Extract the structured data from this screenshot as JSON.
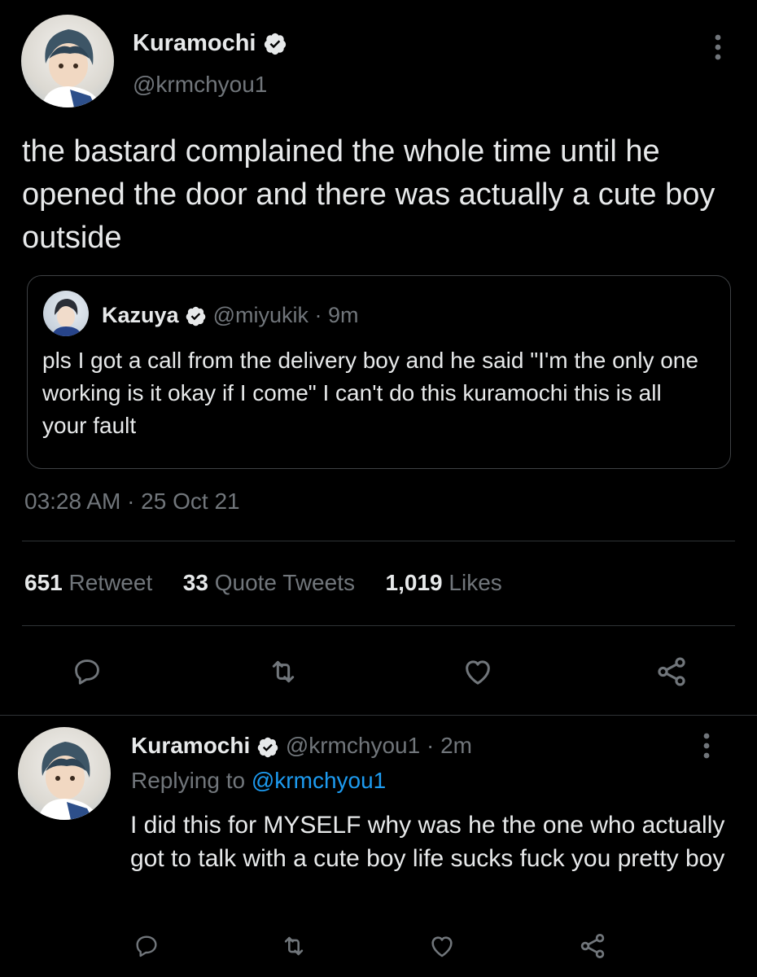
{
  "main_tweet": {
    "author_name": "Kuramochi",
    "author_handle": "@krmchyou1",
    "text": "the bastard complained the whole time until he opened the door and there was actually a cute boy outside",
    "quoted": {
      "author_name": "Kazuya",
      "author_handle": "@miyukik",
      "time": "· 9m",
      "text": "pls I got a call from the delivery boy and he said \"I'm the only one working is it okay if I come\" I can't do this kuramochi this is all your fault"
    },
    "timestamp": "03:28 AM · 25 Oct 21",
    "stats": {
      "retweets": "651",
      "retweets_label": "Retweet",
      "quotes": "33",
      "quotes_label": "Quote Tweets",
      "likes": "1,019",
      "likes_label": "Likes"
    }
  },
  "reply_tweet": {
    "author_name": "Kuramochi",
    "author_handle": "@krmchyou1",
    "time": "· 2m",
    "replying_prefix": "Replying to",
    "replying_handle": "@krmchyou1",
    "text": "I did this for MYSELF why was he the one who actually got to talk with a cute boy life sucks fuck you pretty boy"
  },
  "icons": {
    "more": "more-vertical-icon",
    "reply": "reply-icon",
    "retweet": "retweet-icon",
    "like": "heart-icon",
    "share": "share-icon",
    "verified": "verified-badge-icon"
  },
  "colors": {
    "background": "#000000",
    "text": "#e7e9ea",
    "muted": "#71767b",
    "link": "#1d9bf0",
    "divider": "#2f3336"
  }
}
